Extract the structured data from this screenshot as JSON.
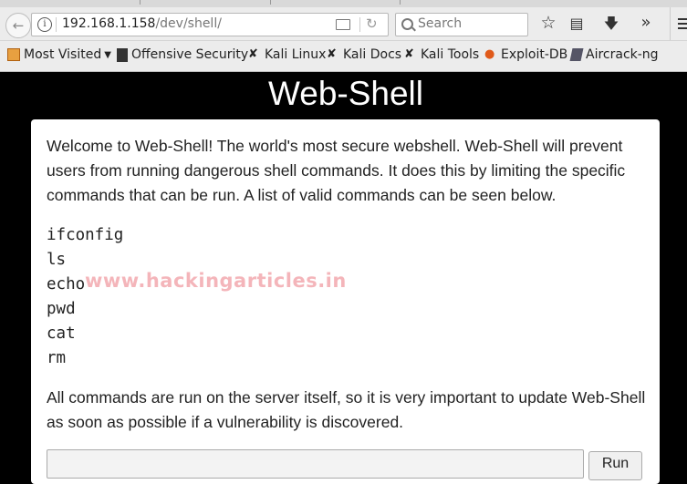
{
  "browser": {
    "url_host": "192.168.1.158",
    "url_path": "/dev/shell/",
    "search_placeholder": "Search",
    "bookmarks": [
      "Most Visited",
      "Offensive Security",
      "Kali Linux",
      "Kali Docs",
      "Kali Tools",
      "Exploit-DB",
      "Aircrack-ng"
    ]
  },
  "page": {
    "title": "Web-Shell",
    "intro": "Welcome to Web-Shell! The world's most secure webshell. Web-Shell will prevent users from running dangerous shell commands. It does this by limiting the specific commands that can be run. A list of valid commands can be seen below.",
    "commands": [
      "ifconfig",
      "ls",
      "echo",
      "pwd",
      "cat",
      "rm"
    ],
    "outro": "All commands are run on the server itself, so it is very important to update Web-Shell as soon as possible if a vulnerability is discovered.",
    "run_label": "Run",
    "command_value": ""
  },
  "watermark": "www.hackingarticles.in"
}
